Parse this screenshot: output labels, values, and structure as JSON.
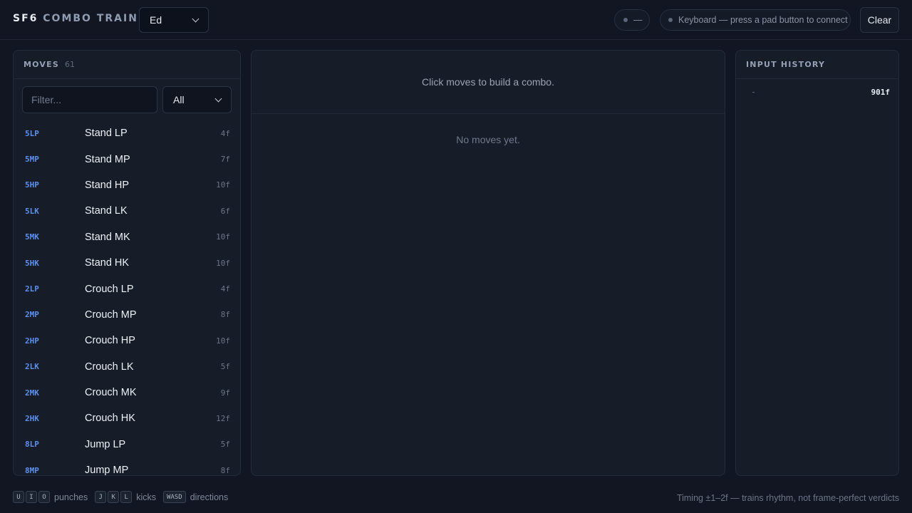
{
  "header": {
    "brand_primary": "SF6",
    "brand_secondary": "COMBO TRAINER",
    "character": "Ed",
    "status_text": "—",
    "input_status": "Keyboard — press a pad button to connect",
    "clear_label": "Clear"
  },
  "moves": {
    "title": "MOVES",
    "count": "61",
    "filter_placeholder": "Filter...",
    "type_filter": "All",
    "items": [
      {
        "notation": "5LP",
        "name": "Stand LP",
        "frames": "4f"
      },
      {
        "notation": "5MP",
        "name": "Stand MP",
        "frames": "7f"
      },
      {
        "notation": "5HP",
        "name": "Stand HP",
        "frames": "10f"
      },
      {
        "notation": "5LK",
        "name": "Stand LK",
        "frames": "6f"
      },
      {
        "notation": "5MK",
        "name": "Stand MK",
        "frames": "10f"
      },
      {
        "notation": "5HK",
        "name": "Stand HK",
        "frames": "10f"
      },
      {
        "notation": "2LP",
        "name": "Crouch LP",
        "frames": "4f"
      },
      {
        "notation": "2MP",
        "name": "Crouch MP",
        "frames": "8f"
      },
      {
        "notation": "2HP",
        "name": "Crouch HP",
        "frames": "10f"
      },
      {
        "notation": "2LK",
        "name": "Crouch LK",
        "frames": "5f"
      },
      {
        "notation": "2MK",
        "name": "Crouch MK",
        "frames": "9f"
      },
      {
        "notation": "2HK",
        "name": "Crouch HK",
        "frames": "12f"
      },
      {
        "notation": "8LP",
        "name": "Jump LP",
        "frames": "5f"
      },
      {
        "notation": "8MP",
        "name": "Jump MP",
        "frames": "8f"
      }
    ]
  },
  "combo": {
    "hint": "Click moves to build a combo.",
    "empty": "No moves yet."
  },
  "history": {
    "title": "INPUT HISTORY",
    "entries": [
      {
        "frames": "901f"
      }
    ]
  },
  "footer": {
    "punch_keys": [
      "U",
      "I",
      "O"
    ],
    "punch_label": "punches",
    "kick_keys": [
      "J",
      "K",
      "L"
    ],
    "kick_label": "kicks",
    "direction_key": "WASD",
    "direction_label": "directions",
    "timing_note": "Timing ±1–2f — trains rhythm, not frame-perfect verdicts"
  },
  "colors": {
    "background": "#111622",
    "panel": "#161c28",
    "accent_notation": "#5b8ff0"
  }
}
